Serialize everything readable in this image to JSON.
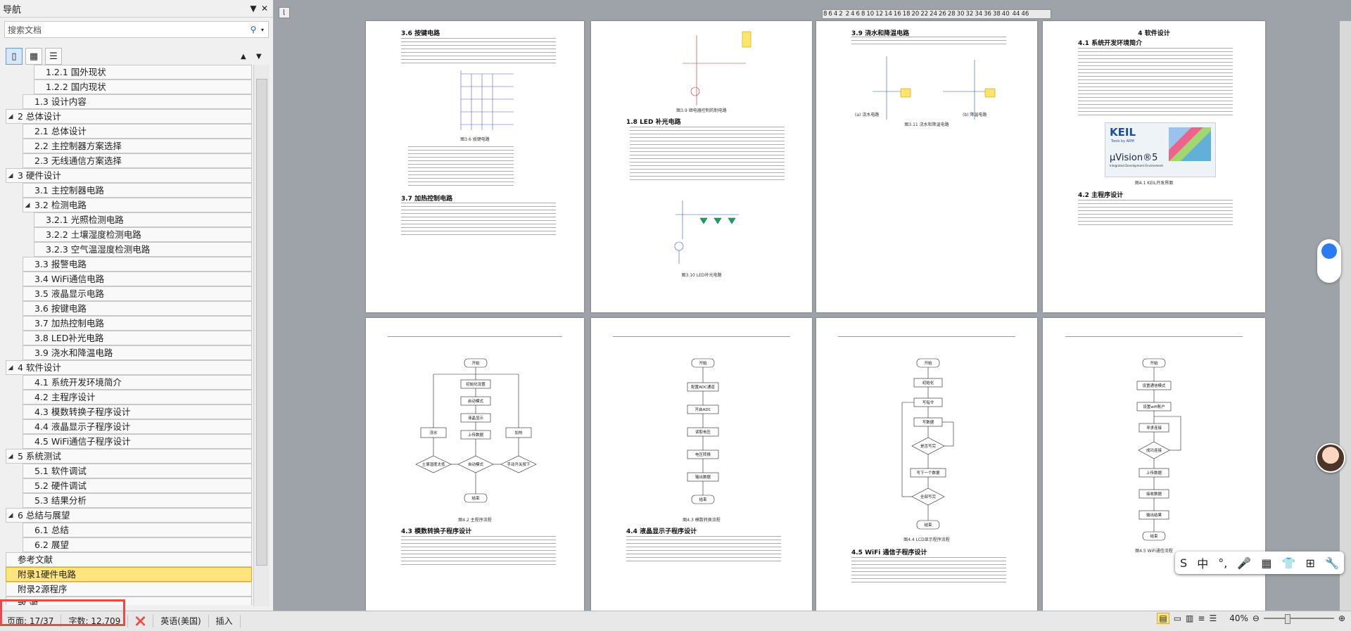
{
  "nav": {
    "title": "导航",
    "search_placeholder": "搜索文档",
    "items": [
      {
        "label": "1.2.1 国外现状",
        "level": 3,
        "expand": ""
      },
      {
        "label": "1.2.2 国内现状",
        "level": 3,
        "expand": ""
      },
      {
        "label": "1.3 设计内容",
        "level": 2,
        "expand": ""
      },
      {
        "label": "2 总体设计",
        "level": 1,
        "expand": "◢"
      },
      {
        "label": "2.1 总体设计",
        "level": 2,
        "expand": ""
      },
      {
        "label": "2.2 主控制器方案选择",
        "level": 2,
        "expand": ""
      },
      {
        "label": "2.3 无线通信方案选择",
        "level": 2,
        "expand": ""
      },
      {
        "label": "3 硬件设计",
        "level": 1,
        "expand": "◢"
      },
      {
        "label": "3.1 主控制器电路",
        "level": 2,
        "expand": ""
      },
      {
        "label": "3.2 检测电路",
        "level": 2,
        "expand": "◢"
      },
      {
        "label": "3.2.1 光照检测电路",
        "level": 3,
        "expand": ""
      },
      {
        "label": "3.2.2 土壤湿度检测电路",
        "level": 3,
        "expand": ""
      },
      {
        "label": "3.2.3 空气温湿度检测电路",
        "level": 3,
        "expand": ""
      },
      {
        "label": "3.3 报警电路",
        "level": 2,
        "expand": ""
      },
      {
        "label": "3.4 WiFi通信电路",
        "level": 2,
        "expand": ""
      },
      {
        "label": "3.5 液晶显示电路",
        "level": 2,
        "expand": ""
      },
      {
        "label": "3.6 按键电路",
        "level": 2,
        "expand": ""
      },
      {
        "label": "3.7 加热控制电路",
        "level": 2,
        "expand": ""
      },
      {
        "label": "3.8 LED补光电路",
        "level": 2,
        "expand": ""
      },
      {
        "label": "3.9 浇水和降温电路",
        "level": 2,
        "expand": ""
      },
      {
        "label": "4 软件设计",
        "level": 1,
        "expand": "◢"
      },
      {
        "label": "4.1 系统开发环境简介",
        "level": 2,
        "expand": ""
      },
      {
        "label": "4.2 主程序设计",
        "level": 2,
        "expand": ""
      },
      {
        "label": "4.3 模数转换子程序设计",
        "level": 2,
        "expand": ""
      },
      {
        "label": "4.4 液晶显示子程序设计",
        "level": 2,
        "expand": ""
      },
      {
        "label": "4.5 WiFi通信子程序设计",
        "level": 2,
        "expand": ""
      },
      {
        "label": "5 系统测试",
        "level": 1,
        "expand": "◢"
      },
      {
        "label": "5.1 软件调试",
        "level": 2,
        "expand": ""
      },
      {
        "label": "5.2 硬件调试",
        "level": 2,
        "expand": ""
      },
      {
        "label": "5.3 结果分析",
        "level": 2,
        "expand": ""
      },
      {
        "label": "6 总结与展望",
        "level": 1,
        "expand": "◢"
      },
      {
        "label": "6.1 总结",
        "level": 2,
        "expand": ""
      },
      {
        "label": "6.2 展望",
        "level": 2,
        "expand": ""
      },
      {
        "label": "参考文献",
        "level": 1,
        "expand": ""
      },
      {
        "label": "附录1硬件电路",
        "level": 1,
        "expand": "",
        "selected": true
      },
      {
        "label": "附录2源程序",
        "level": 1,
        "expand": ""
      },
      {
        "label": "致 谢",
        "level": 1,
        "expand": ""
      }
    ]
  },
  "ruler": [
    "8",
    "6",
    "4",
    "2",
    "",
    "2",
    "4",
    "6",
    "8",
    "10",
    "12",
    "14",
    "16",
    "18",
    "20",
    "22",
    "24",
    "26",
    "28",
    "30",
    "32",
    "34",
    "36",
    "38",
    "40",
    "",
    "44",
    "46"
  ],
  "pages": {
    "p1": {
      "h1": "3.6 按键电路",
      "cap1": "图3.6 按键电路",
      "h2": "3.7 加热控制电路"
    },
    "p2": {
      "cap1": "图3.9 继电器控制的制电路",
      "h1": "1.8 LED 补光电路",
      "cap2": "图3.10 LED补光电路"
    },
    "p3": {
      "h1": "3.9 浇水和降温电路",
      "cap1": "图3.11 浇水和降温电路",
      "sub1": "(a) 浇水电路",
      "sub2": "(b) 降温电路"
    },
    "p4": {
      "head": "4 软件设计",
      "h1": "4.1 系统开发环境简介",
      "keil1": "KEIL",
      "keil2": "Tools by ARM",
      "keil3": "µVision®5",
      "keil4": "Integrated Development Environment",
      "cap1": "图4.1 KEIL开发界面",
      "h2": "4.2 主程序设计"
    },
    "p5": {
      "h1": "4.3 模数转换子程序设计",
      "cap1": "图4.2 主程序流程",
      "f": [
        "开始",
        "初始化设置",
        "启动模式",
        "液晶显示",
        "上传数据",
        "自动模式",
        "浇水",
        "土壤湿度太低",
        "手动开关按下",
        "加热",
        "结束",
        "是",
        "否"
      ]
    },
    "p6": {
      "h1": "4.4 液晶显示子程序设计",
      "cap1": "图4.3 模数转换流程",
      "f": [
        "开始",
        "配置ADC通道",
        "开启ADC",
        "读取电压",
        "电压转换",
        "输出数据",
        "结束"
      ]
    },
    "p7": {
      "h1": "4.5 WiFi 通信子程序设计",
      "cap1": "图4.4 LCD显示程序流程",
      "f": [
        "开始",
        "初始化",
        "写指令",
        "写数据",
        "是否写完",
        "写下一个数据",
        "全部写完",
        "结束",
        "是",
        "否"
      ]
    },
    "p8": {
      "cap1": "图4.5 WiFi通信流程",
      "f": [
        "开始",
        "设置通信模式",
        "设置wifi账户",
        "寻求连接",
        "成功连接",
        "上传数据",
        "接收数据",
        "输出结果",
        "结束",
        "否"
      ]
    }
  },
  "status": {
    "page": "页面: 17/37",
    "words": "字数: 12,709",
    "language": "英语(美国)",
    "mode": "插入",
    "zoom": "40%"
  },
  "floatbar": [
    "S",
    "中",
    "°,",
    "🎤",
    "▦",
    "👕",
    "⊞",
    "🔧"
  ]
}
